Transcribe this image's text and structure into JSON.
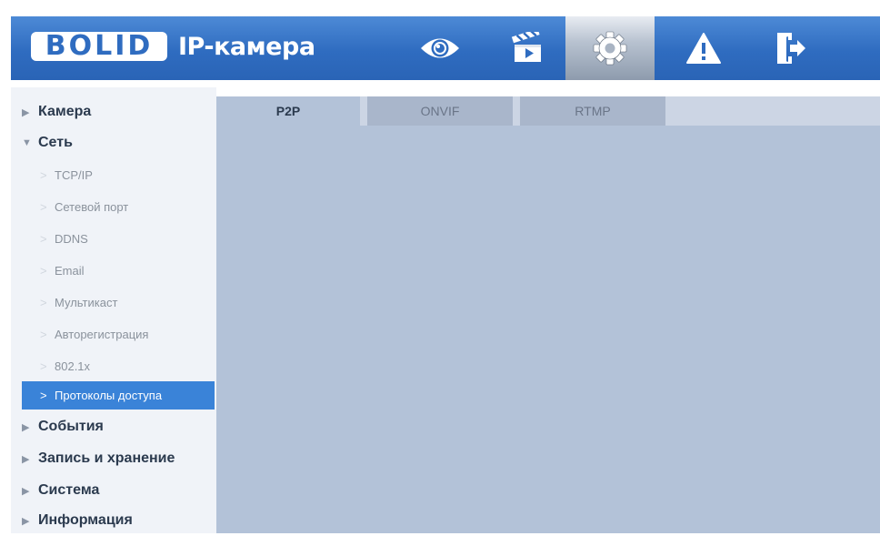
{
  "header": {
    "logo": "BOLID",
    "title": "IP-камера",
    "nav": [
      {
        "icon": "eye-icon",
        "active": false
      },
      {
        "icon": "clapperboard-icon",
        "active": false
      },
      {
        "icon": "gear-icon",
        "active": true
      },
      {
        "icon": "warning-icon",
        "active": false
      },
      {
        "icon": "logout-icon",
        "active": false
      }
    ]
  },
  "sidebar": {
    "items": [
      {
        "arrow": "▶",
        "label": "Камера"
      },
      {
        "arrow": "▼",
        "label": "Сеть"
      },
      {
        "arrow": "▶",
        "label": "События"
      },
      {
        "arrow": "▶",
        "label": "Запись и хранение"
      },
      {
        "arrow": "▶",
        "label": "Система"
      },
      {
        "arrow": "▶",
        "label": "Информация"
      }
    ],
    "network_sub": [
      {
        "label": "TCP/IP"
      },
      {
        "label": "Сетевой порт"
      },
      {
        "label": "DDNS"
      },
      {
        "label": "Email"
      },
      {
        "label": "Мультикаст"
      },
      {
        "label": "Авторегистрация"
      },
      {
        "label": "802.1x"
      },
      {
        "label": "Протоколы доступа",
        "active": true
      }
    ],
    "chevron": ">"
  },
  "tabs": [
    {
      "label": "P2P",
      "active": true
    },
    {
      "label": "ONVIF",
      "active": false
    },
    {
      "label": "RTMP",
      "active": false
    }
  ],
  "colors": {
    "header": "#2f6cc0",
    "active_item": "#3a83d8",
    "content_bg": "#b3c2d8"
  }
}
